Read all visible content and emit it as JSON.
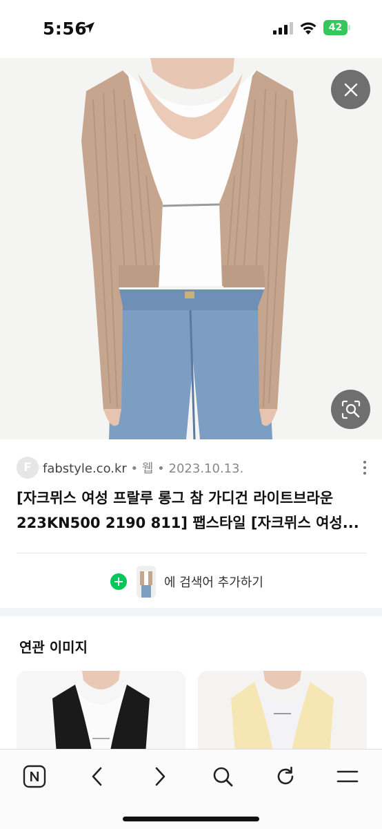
{
  "status_bar": {
    "time": "5:56",
    "battery": "42"
  },
  "result": {
    "favicon_letter": "F",
    "domain": "fabstyle.co.kr",
    "type": " • 웹 • ",
    "date": "2023.10.13.",
    "title": "[자크뮈스 여성 프랄루 롱그 참 가디건 라이트브라운 223KN500 2190 811] 팹스타일 [자크뮈스 여성..."
  },
  "add_search": {
    "label": "에 검색어 추가하기"
  },
  "related": {
    "title": "연관 이미지"
  },
  "icons": {
    "close": "close-icon",
    "lens": "image-search-icon",
    "more": "more-vertical-icon",
    "naver_home": "naver-n-icon",
    "back": "chevron-left-icon",
    "forward": "chevron-right-icon",
    "search": "search-icon",
    "reload": "reload-icon",
    "menu": "menu-icon"
  },
  "colors": {
    "accent_green": "#03c75a",
    "battery_green": "#34c759",
    "overlay_button": "#6f6f6f"
  }
}
